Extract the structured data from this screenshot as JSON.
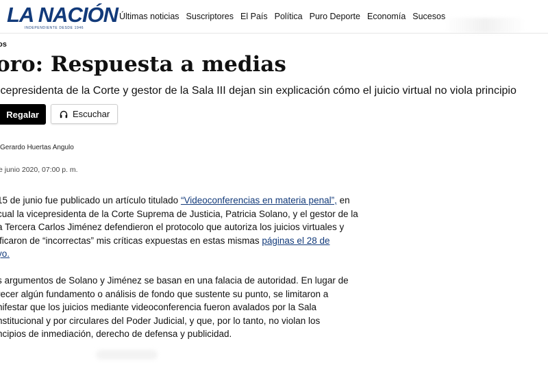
{
  "brand": {
    "name": "LA NACIÓN",
    "tagline": "INDEPENDIENTE DESDE 1946",
    "color": "#123a7a"
  },
  "nav": {
    "items": [
      "Últimas noticias",
      "Suscriptores",
      "El País",
      "Política",
      "Puro Deporte",
      "Economía",
      "Sucesos"
    ]
  },
  "article": {
    "kicker": "os",
    "headline": "oro: Respuesta a medias",
    "subtitle": "icepresidenta de la Corte y gestor de la Sala III dejan sin explicación cómo el juicio virtual no viola principio",
    "gift_label": "Regalar",
    "listen_label": "Escuchar",
    "author": "Gerardo Huertas Angulo",
    "date": "e junio 2020, 07:00 p. m.",
    "paragraph1": {
      "l1_text": "15 de junio fue publicado un artículo titulado ",
      "l1_link": "“Videoconferencias en materia penal”,",
      "l1_end": " en",
      "l2": "cual la vicepresidenta de la Corte Suprema de Justicia, Patricia Solano, y el gestor de la",
      "l3": "a Tercera Carlos Jiménez defendieron el protocolo que autoriza los juicios virtuales y",
      "l4_text": "ificaron de “incorrectas” mis críticas expuestas en estas mismas ",
      "l4_link": "páginas el 28 de",
      "l5_link": "yo."
    },
    "paragraph2": {
      "l1": "s argumentos de Solano y Jiménez se basan en una falacia de autoridad. En lugar de",
      "l2": "recer algún fundamento o análisis de fondo que sustente su punto, se limitaron a",
      "l3": "nifestar que los juicios mediante videoconferencia fueron avalados por la Sala",
      "l4": "nstitucional y por circulares del Poder Judicial, y que, por lo tanto, no violan los",
      "l5": "ncipios de inmediación, derecho de defensa y publicidad."
    }
  }
}
